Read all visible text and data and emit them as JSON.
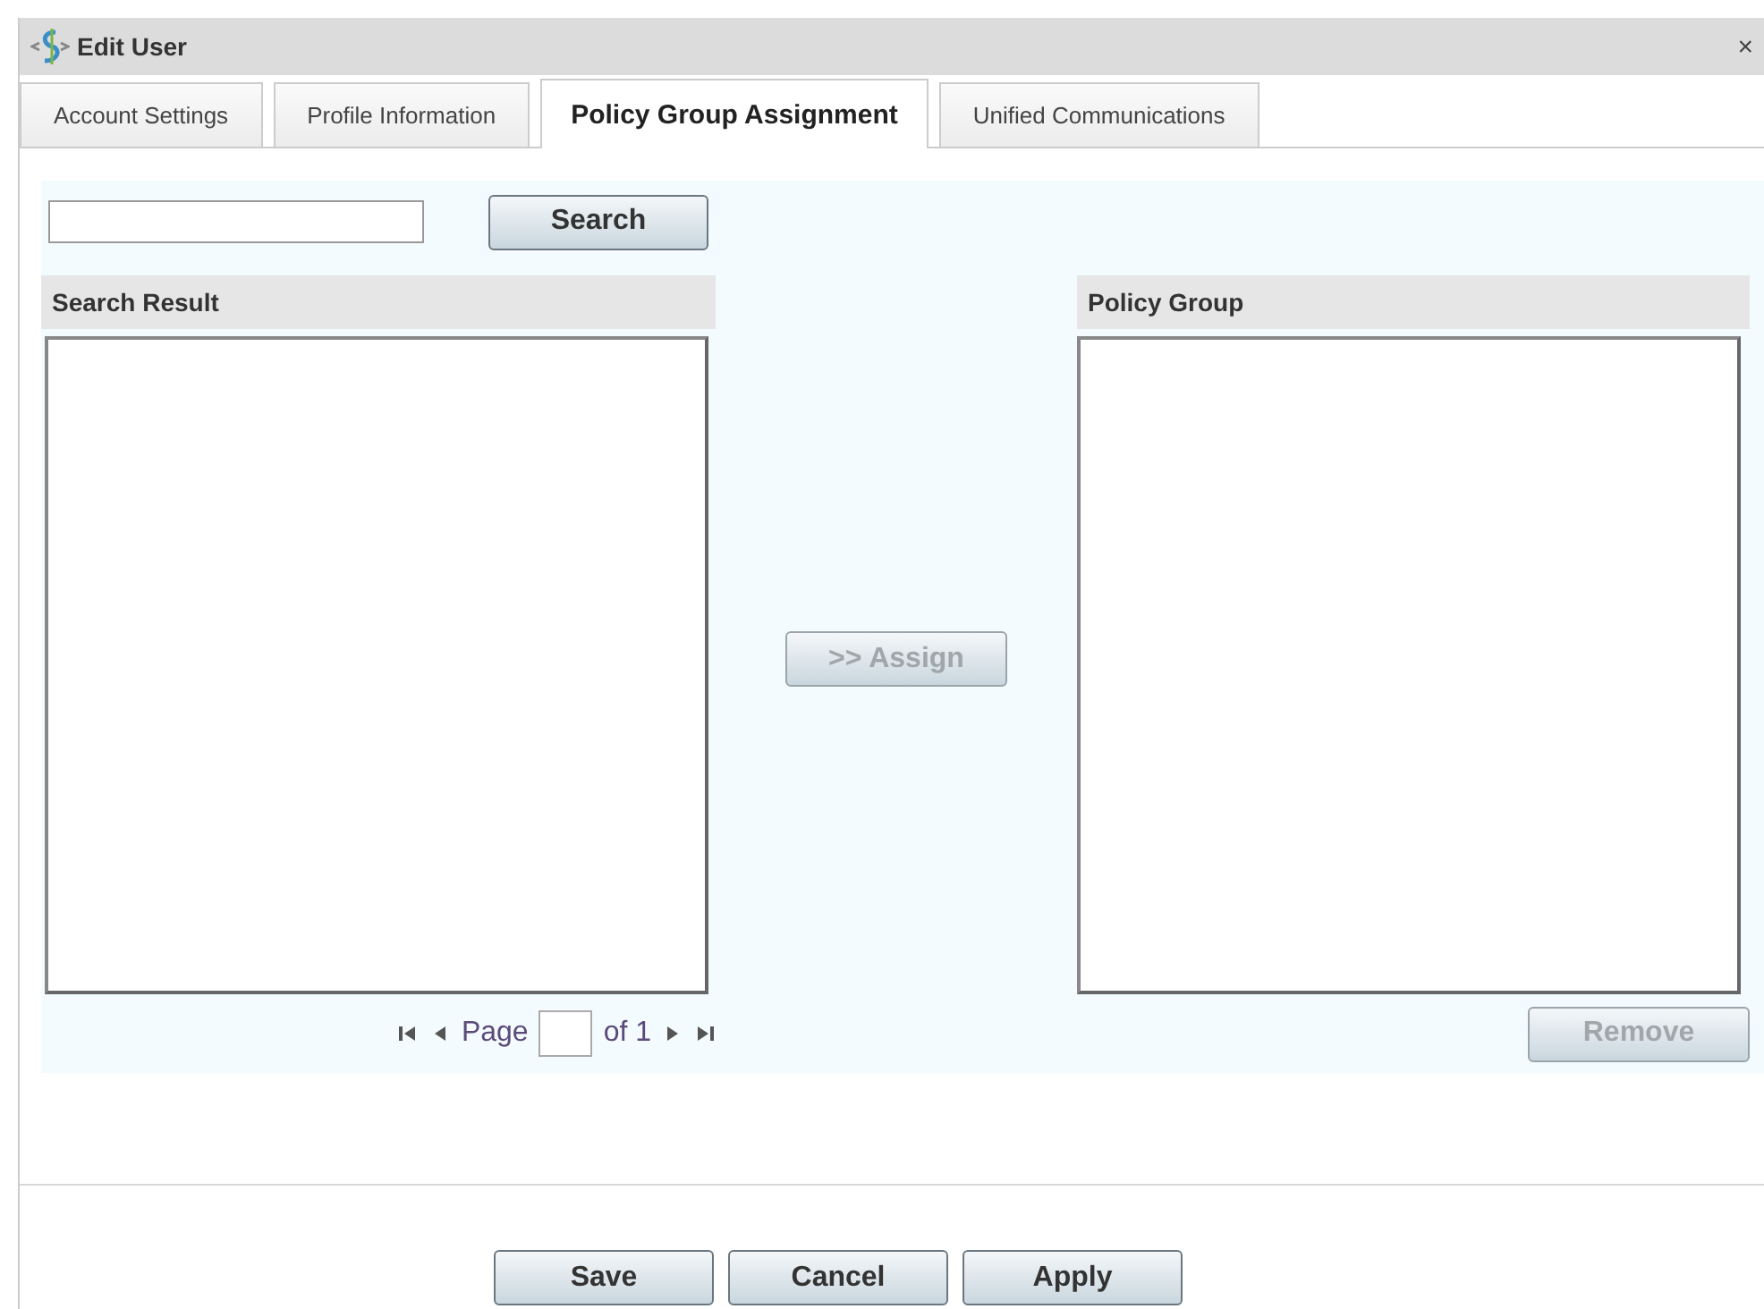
{
  "window": {
    "title": "Edit User",
    "close": "×"
  },
  "tabs": [
    {
      "label": "Account Settings",
      "selected": false
    },
    {
      "label": "Profile Information",
      "selected": false
    },
    {
      "label": "Policy Group Assignment",
      "selected": true
    },
    {
      "label": "Unified Communications",
      "selected": false
    }
  ],
  "search": {
    "button": "Search"
  },
  "search_result": {
    "header": "Search Result",
    "pager": {
      "label": "Page",
      "of": "of 1"
    }
  },
  "assign_button": {
    "label": ">> Assign",
    "disabled": true
  },
  "policy_group": {
    "header": "Policy Group",
    "remove_button": {
      "label": "Remove",
      "disabled": true
    }
  },
  "buttons": [
    {
      "label": "Save"
    },
    {
      "label": "Cancel"
    },
    {
      "label": "Apply"
    }
  ]
}
